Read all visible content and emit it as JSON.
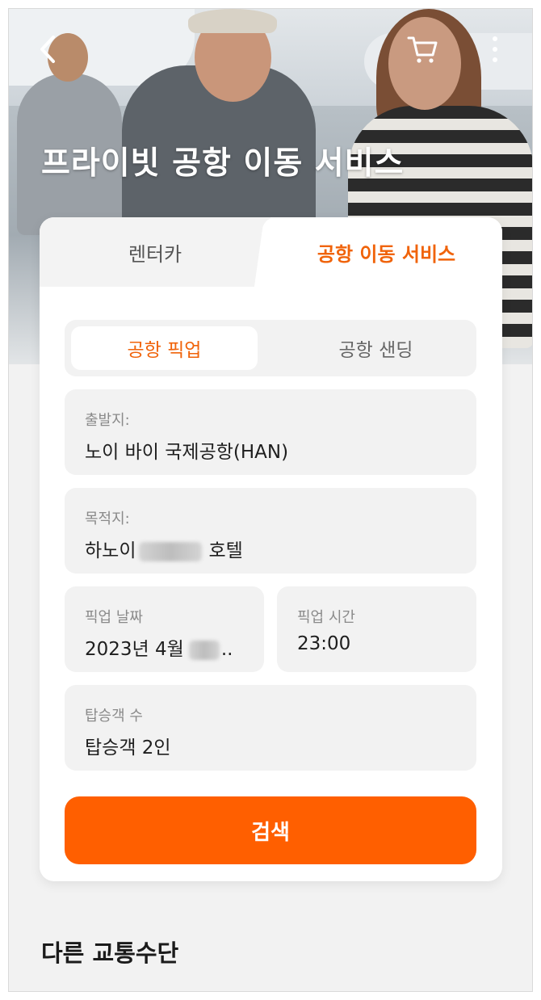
{
  "header": {
    "title": "프라이빗 공항 이동 서비스",
    "back_icon": "chevron-left-icon",
    "cart_icon": "cart-icon",
    "more_icon": "more-vertical-icon"
  },
  "tabs": [
    {
      "label": "렌터카",
      "active": false
    },
    {
      "label": "공항 이동 서비스",
      "active": true
    }
  ],
  "segment": [
    {
      "label": "공항 픽업",
      "active": true
    },
    {
      "label": "공항 샌딩",
      "active": false
    }
  ],
  "form": {
    "departure": {
      "label": "출발지:",
      "value": "노이 바이 국제공항(HAN)"
    },
    "destination": {
      "label": "목적지:",
      "value_prefix": "하노이",
      "value_suffix": "호텔"
    },
    "pickup_date": {
      "label": "픽업 날짜",
      "value_prefix": "2023년 4월",
      "value_suffix": ".."
    },
    "pickup_time": {
      "label": "픽업 시간",
      "value": "23:00"
    },
    "passengers": {
      "label": "탑승객 수",
      "value": "탑승객 2인"
    }
  },
  "search_button": "검색",
  "other_section_title": "다른 교통수단",
  "colors": {
    "accent": "#ff5f00",
    "accent_text": "#f0630a",
    "field_bg": "#f2f2f2"
  }
}
